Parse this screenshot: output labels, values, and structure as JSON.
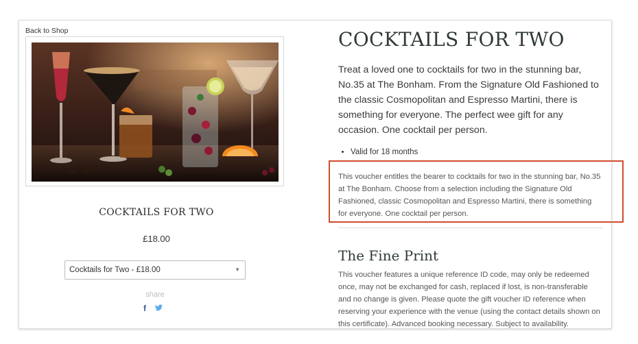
{
  "nav": {
    "back_label": "Back to Shop"
  },
  "product": {
    "left_title": "COCKTAILS FOR TWO",
    "price": "£18.00",
    "select_value": "Cocktails for Two - £18.00",
    "share_label": "share",
    "facebook_glyph": "f",
    "twitter_glyph": "🐦",
    "title": "COCKTAILS FOR TWO",
    "intro": "Treat a loved one to cocktails for two in the stunning bar, No.35 at The Bonham. From the Signature Old Fashioned to the classic Cosmopolitan and Espresso Martini, there is something for everyone.  The perfect wee gift for any occasion. One cocktail per person.",
    "bullets": [
      "Valid for 18 months"
    ],
    "description": "This voucher entitles the bearer to cocktails for two in the stunning bar, No.35 at The Bonham. Choose from a selection including the Signature Old Fashioned, classic Cosmopolitan and Espresso Martini, there is something for everyone. One cocktail per person.",
    "fine_print_title": "The Fine Print",
    "fine_print_text": "This voucher features a unique reference ID code, may only be redeemed once, may not be exchanged for cash, replaced if lost, is non-transferable and no change is given. Please quote the gift voucher ID reference when reserving your experience with the venue (using the contact details shown on this certificate). Advanced booking necessary. Subject to availability."
  },
  "icons": {
    "facebook": "facebook-icon",
    "twitter": "twitter-icon",
    "caret": "chevron-down-icon"
  },
  "colors": {
    "highlight": "#d14b2e",
    "title": "#2f3a33",
    "facebook": "#3b5998",
    "twitter": "#55acee"
  }
}
